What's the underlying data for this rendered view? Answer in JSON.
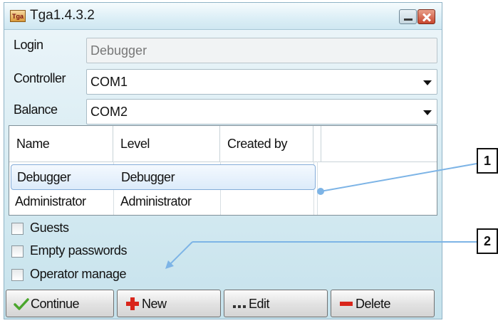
{
  "window": {
    "title": "Tga1.4.3.2",
    "app_icon_text": "Tga"
  },
  "form": {
    "login_label": "Login",
    "login_value": "Debugger",
    "controller_label": "Controller",
    "controller_value": "COM1",
    "balance_label": "Balance",
    "balance_value": "COM2"
  },
  "grid": {
    "columns": [
      "Name",
      "Level",
      "Created by"
    ],
    "rows": [
      {
        "name": "Debugger",
        "level": "Debugger",
        "created_by": "",
        "selected": true
      },
      {
        "name": "Administrator",
        "level": "Administrator",
        "created_by": "",
        "selected": false
      }
    ]
  },
  "options": {
    "guests_label": "Guests",
    "empty_passwords_label": "Empty passwords",
    "operator_manage_label": "Operator manage"
  },
  "buttons": {
    "continue_label": "Continue",
    "new_label": "New",
    "edit_label": "Edit",
    "delete_label": "Delete"
  },
  "callouts": {
    "one": "1",
    "two": "2"
  },
  "colors": {
    "callout_line": "#7db4e6",
    "continue_icon": "#4aa62c",
    "new_icon": "#d9251b",
    "delete_icon": "#d9251b"
  }
}
